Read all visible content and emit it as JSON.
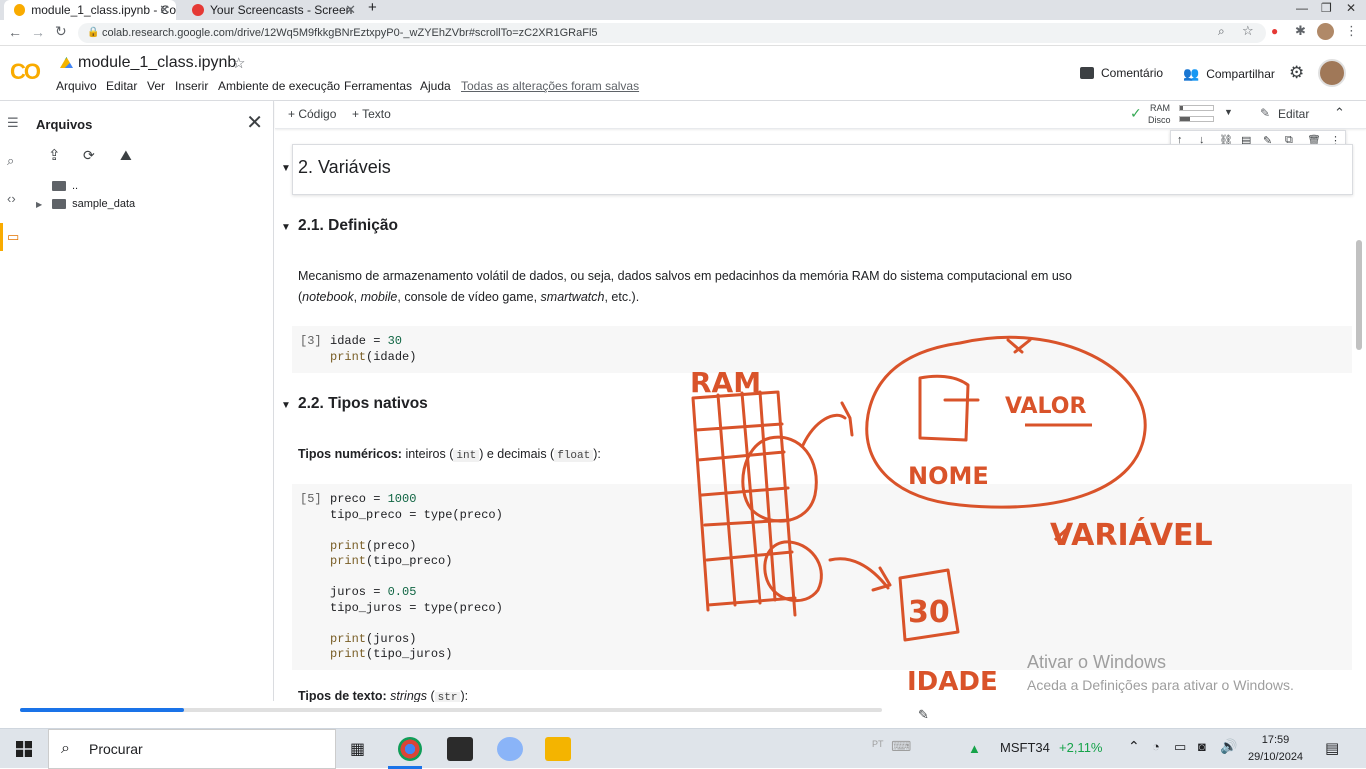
{
  "browser": {
    "tabs": [
      {
        "title": "module_1_class.ipynb - Co",
        "active": true
      },
      {
        "title": "Your Screencasts - Screen",
        "active": false
      }
    ],
    "new_tab": "+",
    "url": "colab.research.google.com/drive/12Wq5M9fkkgBNrEztxpyP0-_wZYEhZVbr#scrollTo=zC2XR1GRaFl5"
  },
  "colab": {
    "logo": "CO",
    "title": "module_1_class.ipynb",
    "menu": [
      "Arquivo",
      "Editar",
      "Ver",
      "Inserir",
      "Ambiente de execução",
      "Ferramentas",
      "Ajuda"
    ],
    "saved_status": "Todas as alterações foram salvas",
    "comment": "Comentário",
    "share": "Compartilhar",
    "toolbar": {
      "add_code": "+ Código",
      "add_text": "+ Texto",
      "ram": "RAM",
      "disk": "Disco",
      "edit": "Editar"
    }
  },
  "sidebar": {
    "title": "Arquivos",
    "items": [
      "..",
      "sample_data"
    ]
  },
  "notebook": {
    "h2": "2. Variáveis",
    "h21": "2.1. Definição",
    "p1_line1": "Mecanismo de armazenamento volátil de dados, ou seja, dados salvos em pedacinhos da memória RAM do sistema computacional em uso",
    "p1_line2_a": "notebook",
    "p1_line2_b": "mobile",
    "p1_line2_c": ", console de vídeo game, ",
    "p1_line2_d": "smartwatch",
    "p1_line2_e": ", etc.).",
    "cell3": {
      "exec": "[3]"
    },
    "h22": "2.2. Tipos nativos",
    "numtypes_bold": "Tipos numéricos:",
    "numtypes_rest1": " inteiros (",
    "numtypes_int": "int",
    "numtypes_rest2": ") e decimais (",
    "numtypes_float": "float",
    "numtypes_rest3": "):",
    "cell5": {
      "exec": "[5]"
    },
    "texttypes_bold": "Tipos de texto:",
    "texttypes_italic": "strings",
    "texttypes_str": "str",
    "texttypes_rest": "):"
  },
  "drawing": {
    "ram_label": "RAM",
    "value_label": "VALOR",
    "name_label": "NOME",
    "variable_label": "VARIÁVEL",
    "age_label": "IDADE",
    "value_box": "30"
  },
  "watermark": {
    "line1": "Ativar o Windows",
    "line2": "Aceda a Definições para ativar o Windows."
  },
  "video": {
    "progress": 0.19
  },
  "taskbar": {
    "search_placeholder": "Procurar",
    "stock": "MSFT34",
    "stock_change": "+2,11%",
    "time": "17:59",
    "date": "29/10/2024"
  },
  "colors": {
    "ink": "#d9532a",
    "accent": "#1a73e8",
    "colab_orange": "#f9ab00"
  }
}
